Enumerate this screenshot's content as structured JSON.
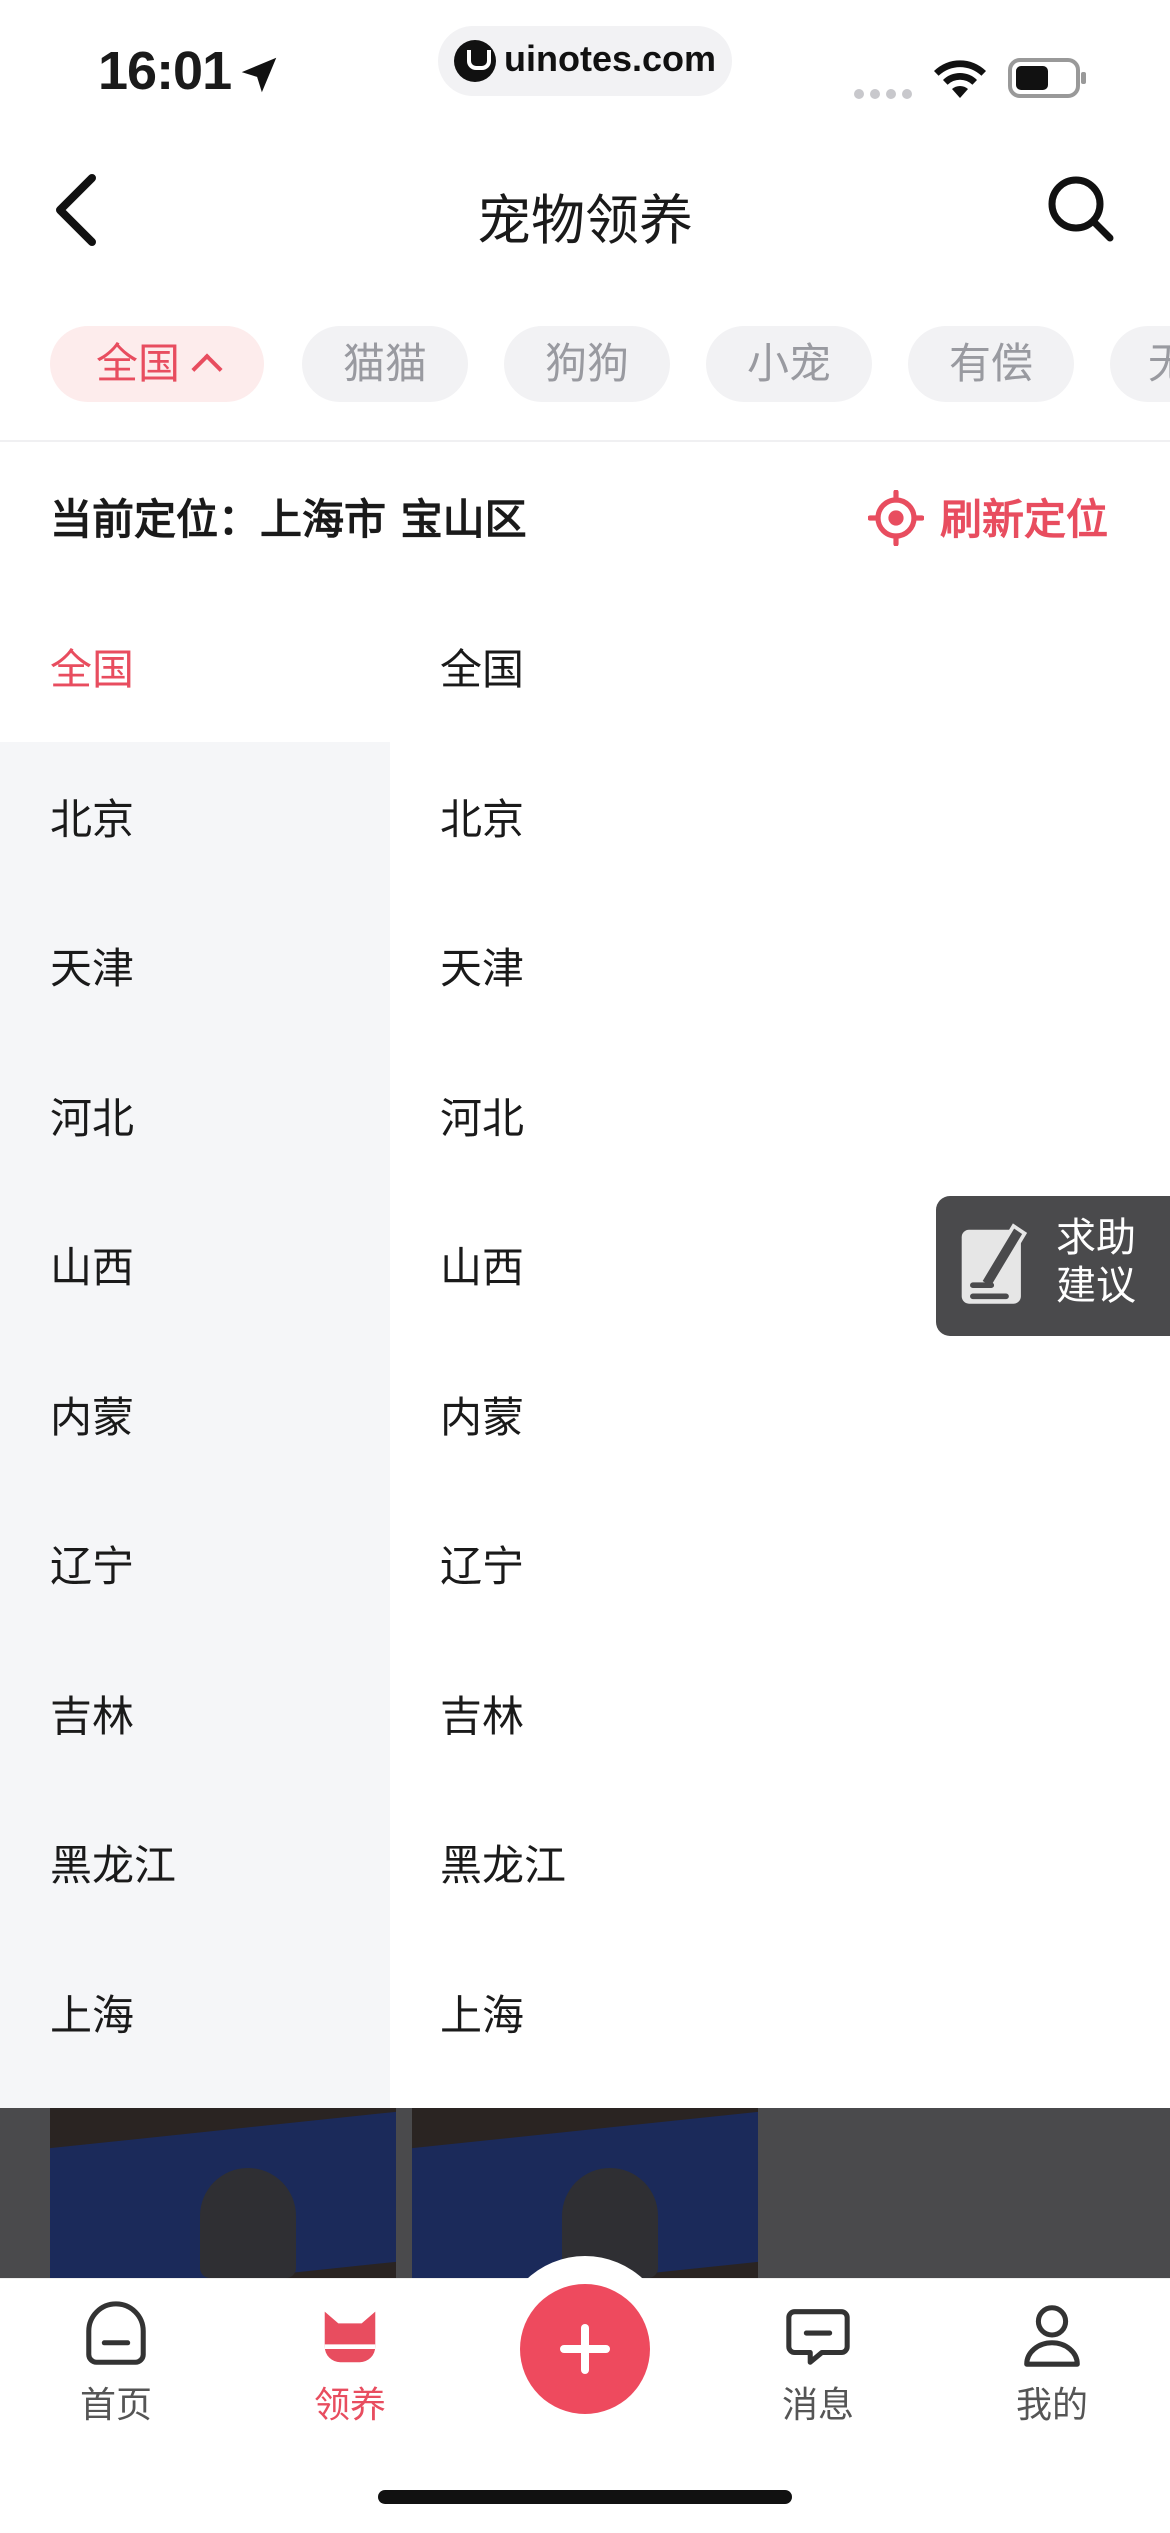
{
  "status_bar": {
    "time": "16:01",
    "url": "uinotes.com"
  },
  "nav": {
    "title": "宠物领养"
  },
  "filters": [
    {
      "label": "全国",
      "active": true
    },
    {
      "label": "猫猫",
      "active": false
    },
    {
      "label": "狗狗",
      "active": false
    },
    {
      "label": "小宠",
      "active": false
    },
    {
      "label": "有偿",
      "active": false
    },
    {
      "label": "无",
      "active": false
    }
  ],
  "location": {
    "current_label": "当前定位：上海市 宝山区",
    "refresh_label": "刷新定位"
  },
  "left_list": [
    "全国",
    "北京",
    "天津",
    "河北",
    "山西",
    "内蒙",
    "辽宁",
    "吉林",
    "黑龙江",
    "上海"
  ],
  "right_list": [
    "全国",
    "北京",
    "天津",
    "河北",
    "山西",
    "内蒙",
    "辽宁",
    "吉林",
    "黑龙江",
    "上海"
  ],
  "help": {
    "line1": "求助",
    "line2": "建议"
  },
  "tabs": [
    {
      "label": "首页",
      "icon": "home-icon"
    },
    {
      "label": "领养",
      "icon": "cat-icon",
      "active": true
    },
    {
      "label": "",
      "icon": "add-icon"
    },
    {
      "label": "消息",
      "icon": "message-icon"
    },
    {
      "label": "我的",
      "icon": "profile-icon"
    }
  ],
  "colors": {
    "accent": "#e84d5f",
    "chip_bg": "#f2f2f4",
    "active_chip_bg": "#fdecec",
    "left_panel_bg": "#f5f6f8"
  }
}
